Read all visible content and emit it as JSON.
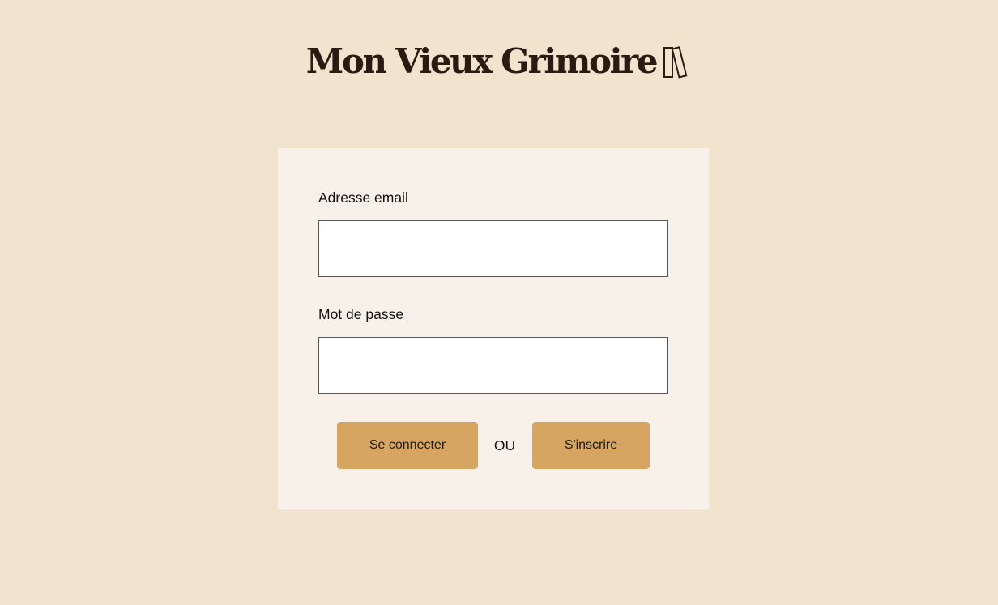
{
  "header": {
    "logo_text": "Mon Vieux Grimoire",
    "logo_icon": "books-icon"
  },
  "login_form": {
    "email_label": "Adresse email",
    "email_value": "",
    "password_label": "Mot de passe",
    "password_value": "",
    "login_button_label": "Se connecter",
    "separator_text": "OU",
    "signup_button_label": "S'inscrire"
  },
  "colors": {
    "page_background": "#F2E3CE",
    "card_background": "#F7F1EA",
    "button_background": "#D7A562",
    "logo_text": "#2A1A12"
  }
}
